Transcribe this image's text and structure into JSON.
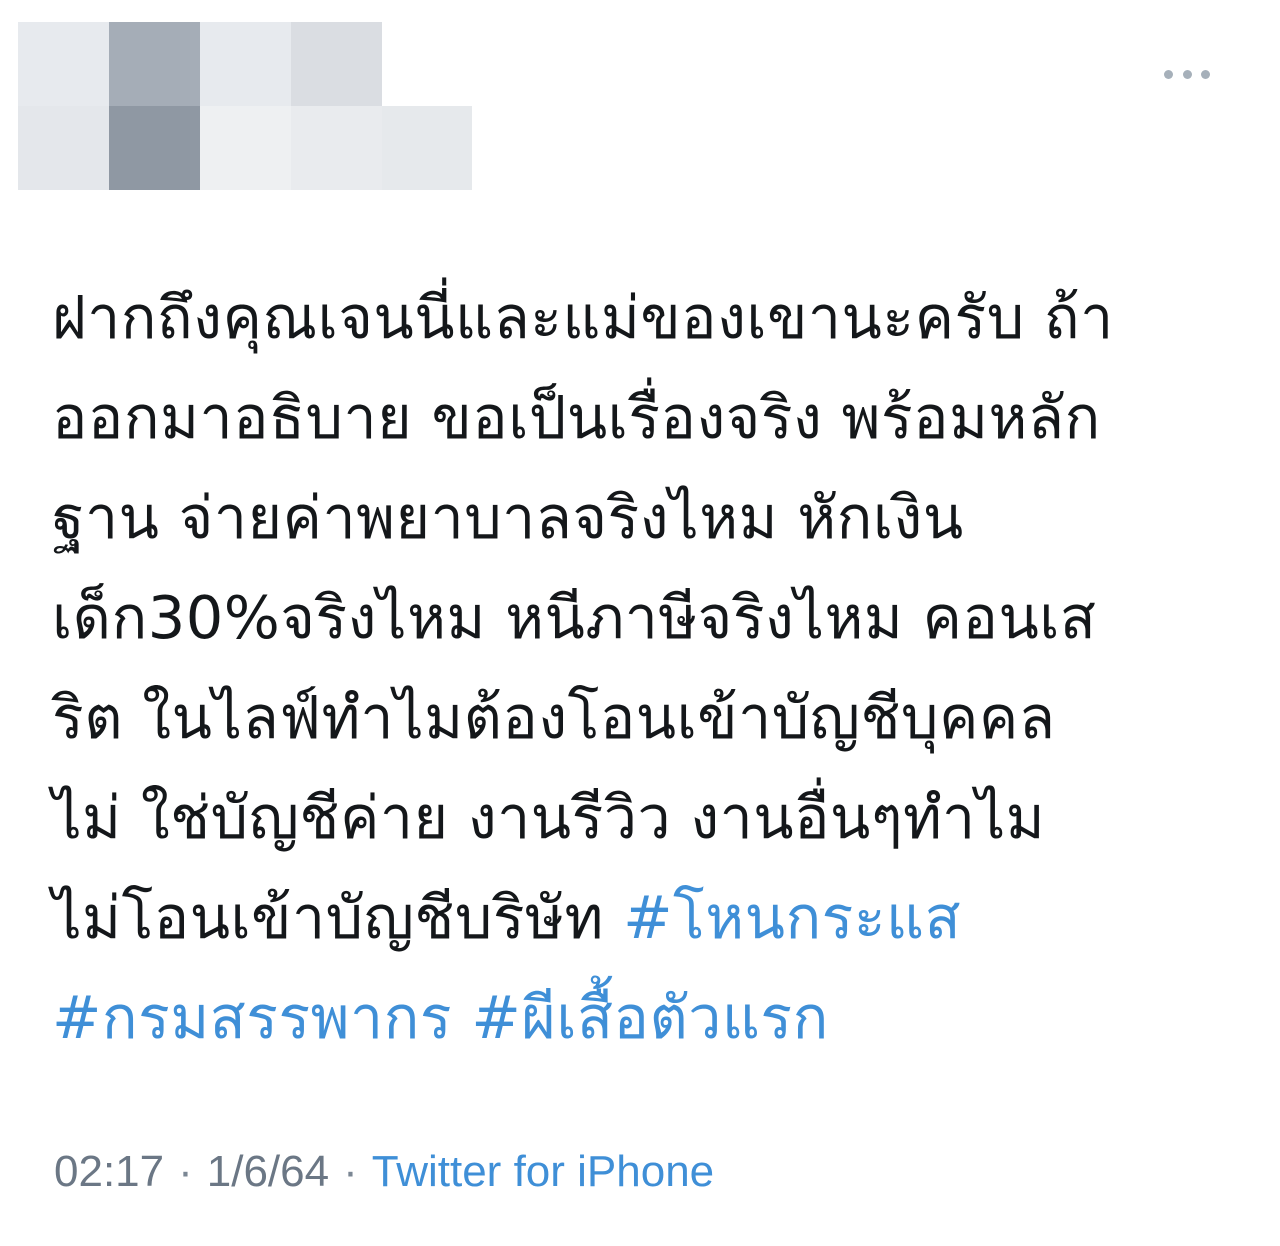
{
  "tweet": {
    "lines": [
      [
        {
          "text": "ฝากถึงคุณเจนนี่และแม่ของเขานะครับ ถ้า",
          "hashtag": false
        }
      ],
      [
        {
          "text": "ออกมาอธิบาย ขอเป็นเรื่องจริง พร้อมหลัก",
          "hashtag": false
        }
      ],
      [
        {
          "text": "ฐาน จ่ายค่าพยาบาลจริงไหม หักเงิน",
          "hashtag": false
        }
      ],
      [
        {
          "text": "เด็ก30%จริงไหม หนีภาษีจริงไหม คอนเส",
          "hashtag": false
        }
      ],
      [
        {
          "text": "ริต ในไลฟ์ทำไมต้องโอนเข้าบัญชีบุคคล",
          "hashtag": false
        }
      ],
      [
        {
          "text": "ไม่ ใช่บัญชีค่าย งานรีวิว งานอื่นๆทำไม",
          "hashtag": false
        }
      ],
      [
        {
          "text": "ไม่โอนเข้าบัญชีบริษัท ",
          "hashtag": false
        },
        {
          "text": "#โหนกระแส",
          "hashtag": true
        }
      ],
      [
        {
          "text": "#กรมสรรพากร",
          "hashtag": true
        },
        {
          "text": " ",
          "hashtag": false
        },
        {
          "text": "#ผีเสื้อตัวแรก",
          "hashtag": true
        }
      ]
    ]
  },
  "meta": {
    "time": "02:17",
    "separator": "·",
    "date": "1/6/64",
    "source": "Twitter for iPhone"
  },
  "icons": {
    "more": "more-horizontal-icon"
  },
  "colors": {
    "text": "#14171a",
    "link": "#3f8fd7",
    "muted": "#6b7785",
    "dots": "#a6b0ba"
  }
}
